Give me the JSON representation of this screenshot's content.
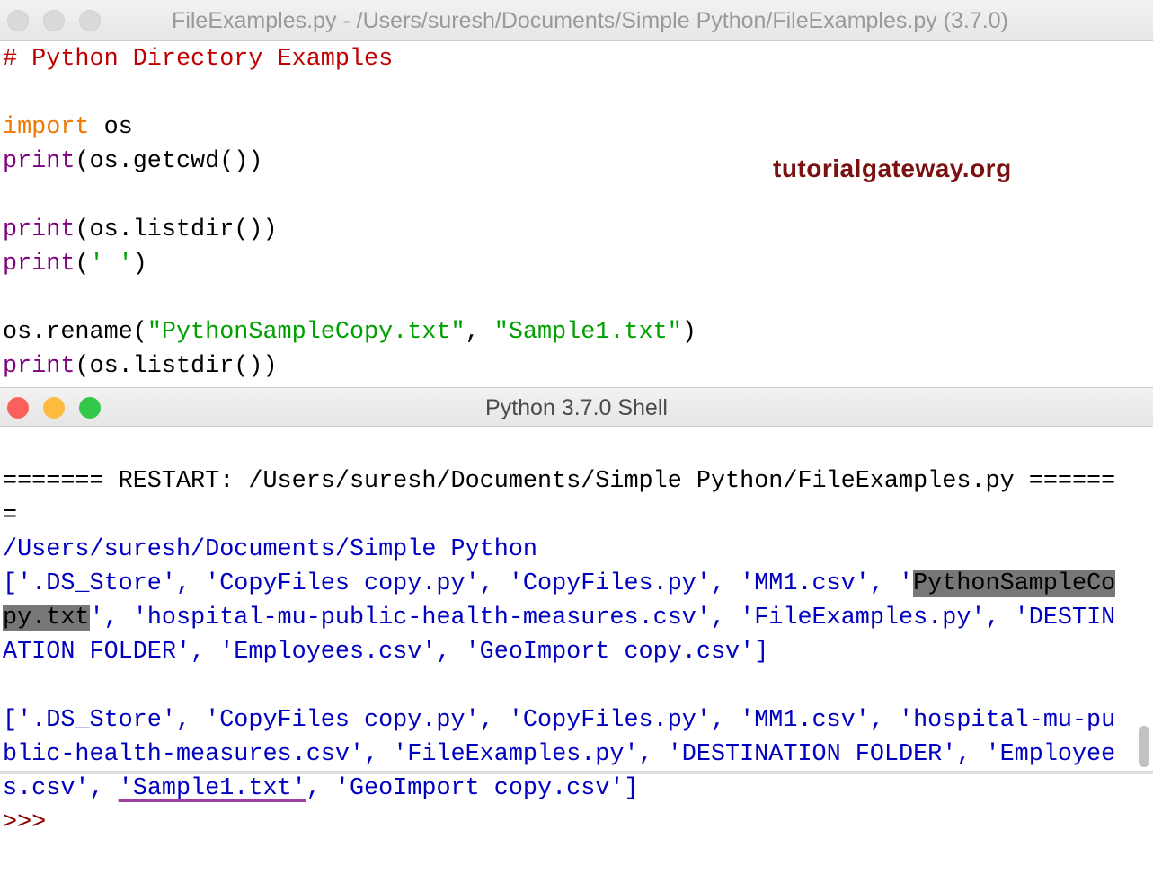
{
  "editor": {
    "title": "FileExamples.py - /Users/suresh/Documents/Simple Python/FileExamples.py (3.7.0)",
    "lines": [
      [
        {
          "t": "# Python Directory Examples",
          "c": "comment"
        }
      ],
      [],
      [
        {
          "t": "import",
          "c": "kw"
        },
        {
          "t": " os",
          "c": "plain"
        }
      ],
      [
        {
          "t": "print",
          "c": "builtin"
        },
        {
          "t": "(os.getcwd())",
          "c": "plain"
        }
      ],
      [],
      [
        {
          "t": "print",
          "c": "builtin"
        },
        {
          "t": "(os.listdir())",
          "c": "plain"
        }
      ],
      [
        {
          "t": "print",
          "c": "builtin"
        },
        {
          "t": "(",
          "c": "plain"
        },
        {
          "t": "' '",
          "c": "str"
        },
        {
          "t": ")",
          "c": "plain"
        }
      ],
      [],
      [
        {
          "t": "os.rename(",
          "c": "plain"
        },
        {
          "t": "\"PythonSampleCopy.txt\"",
          "c": "str"
        },
        {
          "t": ", ",
          "c": "plain"
        },
        {
          "t": "\"Sample1.txt\"",
          "c": "str"
        },
        {
          "t": ")",
          "c": "plain"
        }
      ],
      [
        {
          "t": "print",
          "c": "builtin"
        },
        {
          "t": "(os.listdir())",
          "c": "plain"
        }
      ]
    ]
  },
  "watermark": "tutorialgateway.org",
  "shell": {
    "title": "Python 3.7.0 Shell",
    "restart": "======= RESTART: /Users/suresh/Documents/Simple Python/FileExamples.py =======",
    "cwd": "/Users/suresh/Documents/Simple Python",
    "list1_before": "['.DS_Store', 'CopyFiles copy.py', 'CopyFiles.py', 'MM1.csv', '",
    "list1_selected": "PythonSampleCopy.txt",
    "list1_after": "', 'hospital-mu-public-health-measures.csv', 'FileExamples.py', 'DESTINATION FOLDER', 'Employees.csv', 'GeoImport copy.csv']",
    "list2_before": "['.DS_Store', 'CopyFiles copy.py', 'CopyFiles.py', 'MM1.csv', 'hospital-mu-public-health-measures.csv', 'FileExamples.py', 'DESTINATION FOLDER', 'Employees.csv', ",
    "list2_highlight": "'Sample1.txt'",
    "list2_after": ", 'GeoImport copy.csv']",
    "prompt": ">>>"
  },
  "colors": {
    "close": "#fc605c",
    "minimize": "#fdbc40",
    "zoom": "#34c84a"
  }
}
